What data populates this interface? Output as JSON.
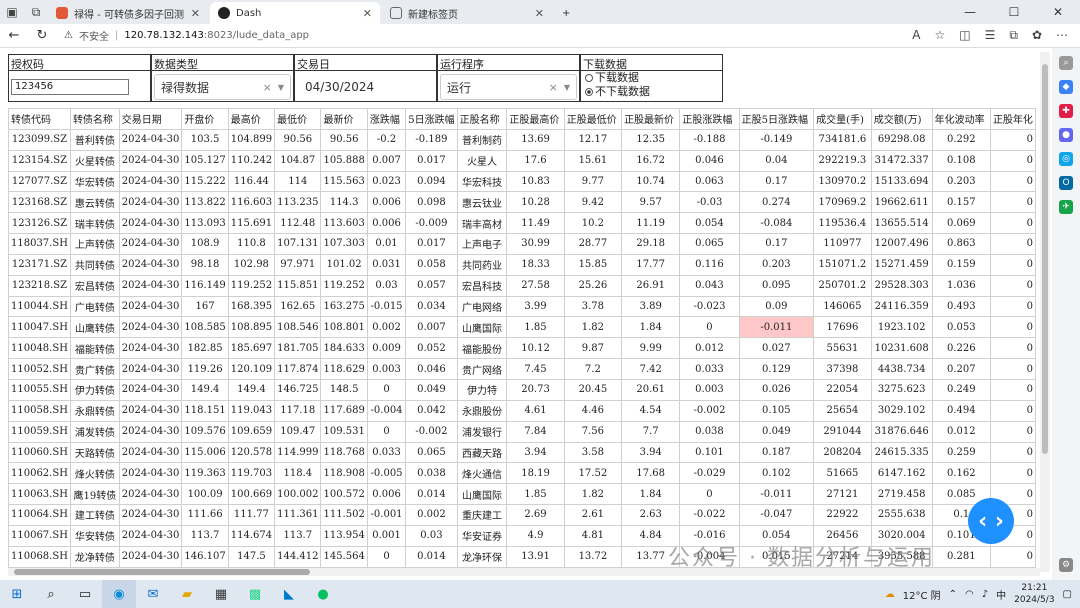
{
  "browser": {
    "tabs": [
      {
        "title": "禄得 - 可转债多因子回测",
        "active": false
      },
      {
        "title": "Dash",
        "active": true
      },
      {
        "title": "新建标签页",
        "active": false
      }
    ],
    "new_tab": "+",
    "address": {
      "security": "不安全",
      "host": "120.78.132.143",
      "path": ":8023/lude_data_app"
    }
  },
  "filters": {
    "auth_label": "授权码",
    "auth_value": "123456",
    "type_label": "数据类型",
    "type_value": "禄得数据",
    "date_label": "交易日",
    "date_value": "04/30/2024",
    "program_label": "运行程序",
    "program_value": "运行",
    "download_label": "下载数据",
    "download_options": [
      "下载数据",
      "不下载数据"
    ],
    "download_selected": 1
  },
  "table": {
    "columns": [
      "转债代码",
      "转债名称",
      "交易日期",
      "开盘价",
      "最高价",
      "最低价",
      "最新价",
      "涨跌幅",
      "5日涨跌幅",
      "正股名称",
      "正股最高价",
      "正股最低价",
      "正股最新价",
      "正股涨跌幅",
      "正股5日涨跌幅",
      "成交量(手)",
      "成交额(万)",
      "年化波动率",
      "正股年化"
    ],
    "rows": [
      [
        "123099.SZ",
        "普利转债",
        "2024-04-30",
        "103.5",
        "104.899",
        "90.56",
        "90.56",
        "-0.2",
        "-0.189",
        "普利制药",
        "13.69",
        "12.17",
        "12.35",
        "-0.188",
        "-0.149",
        "734181.6",
        "69298.08",
        "0.292",
        "0"
      ],
      [
        "123154.SZ",
        "火星转债",
        "2024-04-30",
        "105.127",
        "110.242",
        "104.87",
        "105.888",
        "0.007",
        "0.017",
        "火星人",
        "17.6",
        "15.61",
        "16.72",
        "0.046",
        "0.04",
        "292219.3",
        "31472.337",
        "0.108",
        "0"
      ],
      [
        "127077.SZ",
        "华宏转债",
        "2024-04-30",
        "115.222",
        "116.44",
        "114",
        "115.563",
        "0.023",
        "0.094",
        "华宏科技",
        "10.83",
        "9.77",
        "10.74",
        "0.063",
        "0.17",
        "130970.2",
        "15133.694",
        "0.203",
        "0"
      ],
      [
        "123168.SZ",
        "惠云转债",
        "2024-04-30",
        "113.822",
        "116.603",
        "113.235",
        "114.3",
        "0.006",
        "0.098",
        "惠云钛业",
        "10.28",
        "9.42",
        "9.57",
        "-0.03",
        "0.274",
        "170969.2",
        "19662.611",
        "0.157",
        "0"
      ],
      [
        "123126.SZ",
        "瑞丰转债",
        "2024-04-30",
        "113.093",
        "115.691",
        "112.48",
        "113.603",
        "0.006",
        "-0.009",
        "瑞丰高材",
        "11.49",
        "10.2",
        "11.19",
        "0.054",
        "-0.084",
        "119536.4",
        "13655.514",
        "0.069",
        "0"
      ],
      [
        "118037.SH",
        "上声转债",
        "2024-04-30",
        "108.9",
        "110.8",
        "107.131",
        "107.303",
        "0.01",
        "0.017",
        "上声电子",
        "30.99",
        "28.77",
        "29.18",
        "0.065",
        "0.17",
        "110977",
        "12007.496",
        "0.863",
        "0"
      ],
      [
        "123171.SZ",
        "共同转债",
        "2024-04-30",
        "98.18",
        "102.98",
        "97.971",
        "101.02",
        "0.031",
        "0.058",
        "共同药业",
        "18.33",
        "15.85",
        "17.77",
        "0.116",
        "0.203",
        "151071.2",
        "15271.459",
        "0.159",
        "0"
      ],
      [
        "123218.SZ",
        "宏昌转债",
        "2024-04-30",
        "116.149",
        "119.252",
        "115.851",
        "119.252",
        "0.03",
        "0.057",
        "宏昌科技",
        "27.58",
        "25.26",
        "26.91",
        "0.043",
        "0.095",
        "250701.2",
        "29528.303",
        "1.036",
        "0"
      ],
      [
        "110044.SH",
        "广电转债",
        "2024-04-30",
        "167",
        "168.395",
        "162.65",
        "163.275",
        "-0.015",
        "0.034",
        "广电网络",
        "3.99",
        "3.78",
        "3.89",
        "-0.023",
        "0.09",
        "146065",
        "24116.359",
        "0.493",
        "0"
      ],
      [
        "110047.SH",
        "山鹰转债",
        "2024-04-30",
        "108.585",
        "108.895",
        "108.546",
        "108.801",
        "0.002",
        "0.007",
        "山鹰国际",
        "1.85",
        "1.82",
        "1.84",
        "0",
        "-0.011",
        "17696",
        "1923.102",
        "0.053",
        "0"
      ],
      [
        "110048.SH",
        "福能转债",
        "2024-04-30",
        "182.85",
        "185.697",
        "181.705",
        "184.633",
        "0.009",
        "0.052",
        "福能股份",
        "10.12",
        "9.87",
        "9.99",
        "0.012",
        "0.027",
        "55631",
        "10231.608",
        "0.226",
        "0"
      ],
      [
        "110052.SH",
        "贵广转债",
        "2024-04-30",
        "119.26",
        "120.109",
        "117.874",
        "118.629",
        "0.003",
        "0.046",
        "贵广网络",
        "7.45",
        "7.2",
        "7.42",
        "0.033",
        "0.129",
        "37398",
        "4438.734",
        "0.207",
        "0"
      ],
      [
        "110055.SH",
        "伊力转债",
        "2024-04-30",
        "149.4",
        "149.4",
        "146.725",
        "148.5",
        "0",
        "0.049",
        "伊力特",
        "20.73",
        "20.45",
        "20.61",
        "0.003",
        "0.026",
        "22054",
        "3275.623",
        "0.249",
        "0"
      ],
      [
        "110058.SH",
        "永鼎转债",
        "2024-04-30",
        "118.151",
        "119.043",
        "117.18",
        "117.689",
        "-0.004",
        "0.042",
        "永鼎股份",
        "4.61",
        "4.46",
        "4.54",
        "-0.002",
        "0.105",
        "25654",
        "3029.102",
        "0.494",
        "0"
      ],
      [
        "110059.SH",
        "浦发转债",
        "2024-04-30",
        "109.576",
        "109.659",
        "109.47",
        "109.531",
        "0",
        "-0.002",
        "浦发银行",
        "7.84",
        "7.56",
        "7.7",
        "0.038",
        "0.049",
        "291044",
        "31876.646",
        "0.012",
        "0"
      ],
      [
        "110060.SH",
        "天路转债",
        "2024-04-30",
        "115.006",
        "120.578",
        "114.999",
        "118.768",
        "0.033",
        "0.065",
        "西藏天路",
        "3.94",
        "3.58",
        "3.94",
        "0.101",
        "0.187",
        "208204",
        "24615.335",
        "0.259",
        "0"
      ],
      [
        "110062.SH",
        "烽火转债",
        "2024-04-30",
        "119.363",
        "119.703",
        "118.4",
        "118.908",
        "-0.005",
        "0.038",
        "烽火通信",
        "18.19",
        "17.52",
        "17.68",
        "-0.029",
        "0.102",
        "51665",
        "6147.162",
        "0.162",
        "0"
      ],
      [
        "110063.SH",
        "鹰19转债",
        "2024-04-30",
        "100.09",
        "100.669",
        "100.002",
        "100.572",
        "0.006",
        "0.014",
        "山鹰国际",
        "1.85",
        "1.82",
        "1.84",
        "0",
        "-0.011",
        "27121",
        "2719.458",
        "0.085",
        "0"
      ],
      [
        "110064.SH",
        "建工转债",
        "2024-04-30",
        "111.66",
        "111.77",
        "111.361",
        "111.502",
        "-0.001",
        "0.002",
        "重庆建工",
        "2.69",
        "2.61",
        "2.63",
        "-0.022",
        "-0.047",
        "22922",
        "2555.638",
        "0.1",
        "0"
      ],
      [
        "110067.SH",
        "华安转债",
        "2024-04-30",
        "113.7",
        "114.674",
        "113.7",
        "113.954",
        "0.001",
        "0.03",
        "华安证券",
        "4.9",
        "4.81",
        "4.84",
        "-0.016",
        "0.054",
        "26456",
        "3020.004",
        "0.101",
        "0"
      ],
      [
        "110068.SH",
        "龙净转债",
        "2024-04-30",
        "146.107",
        "147.5",
        "144.412",
        "145.564",
        "0",
        "0.014",
        "龙净环保",
        "13.91",
        "13.72",
        "13.77",
        "-0.004",
        "0.015",
        "27214",
        "3955.588",
        "0.281",
        "0"
      ]
    ],
    "highlight": {
      "row": 9,
      "col": 14,
      "color": "#ffc7c7"
    }
  },
  "watermark": "公众号 · 数据分析与运用",
  "taskbar": {
    "weather": "12°C 阴",
    "ime": "中",
    "time": "21:21",
    "date": "2024/5/3"
  }
}
